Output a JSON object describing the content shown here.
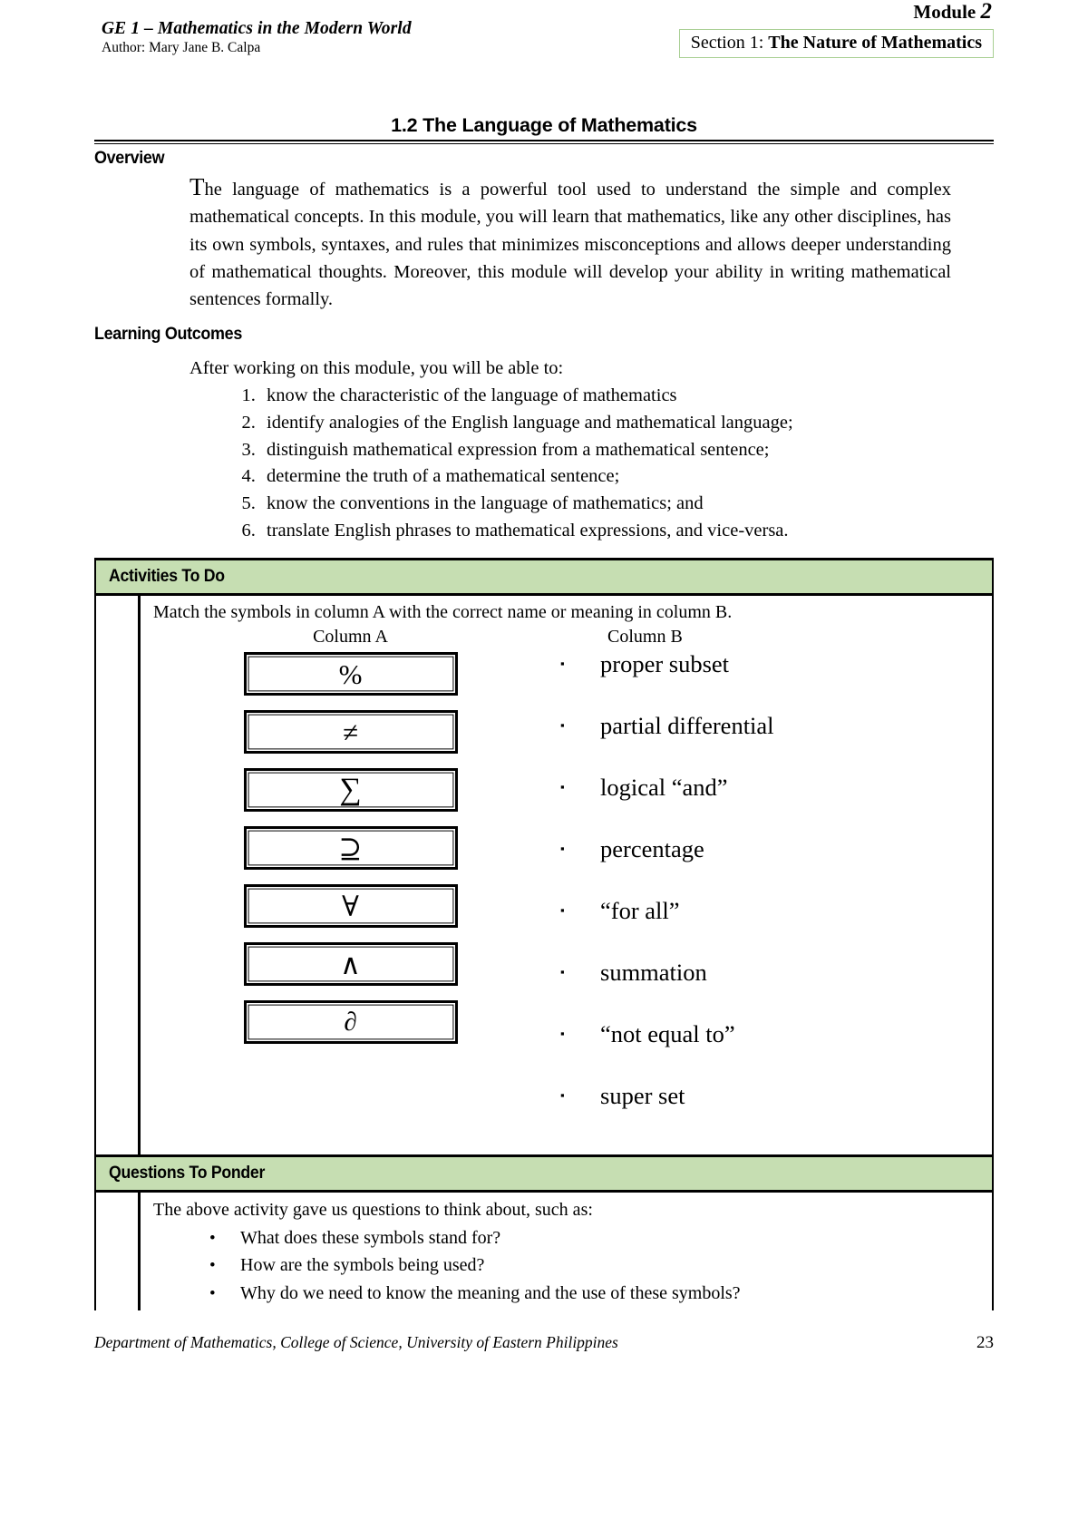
{
  "header": {
    "course_title": "GE 1 – Mathematics in the Modern World",
    "author": "Author: Mary Jane B. Calpa",
    "module_label": "Module",
    "module_number": "2",
    "section_label": "Section 1:",
    "section_name": "The Nature of Mathematics"
  },
  "doc_title": "1.2 The Language of Mathematics",
  "overview": {
    "heading": "Overview",
    "dropcap": "T",
    "paragraph": "he language of mathematics is a powerful tool used to understand the simple and complex mathematical concepts. In this module, you will learn that mathematics, like any other disciplines, has its own symbols, syntaxes, and rules that minimizes misconceptions and allows deeper understanding of mathematical thoughts. Moreover, this module will develop your ability in writing mathematical sentences formally."
  },
  "learning_outcomes": {
    "heading": "Learning Outcomes",
    "lead": "After working on this module, you will be able to:",
    "items": [
      "know the characteristic of the language of mathematics",
      "identify analogies of the English language and mathematical language;",
      "distinguish mathematical expression from a mathematical sentence;",
      "determine the truth of a mathematical sentence;",
      "know the conventions in the language of mathematics; and",
      "translate English phrases to mathematical expressions, and vice-versa."
    ]
  },
  "activities": {
    "heading": "Activities To Do",
    "instruction": "Match the symbols in column A with the correct name or meaning in column B.",
    "column_a_heading": "Column A",
    "column_b_heading": "Column B",
    "column_a_symbols": [
      {
        "glyph": "%",
        "name": "percent-symbol"
      },
      {
        "glyph": "≠",
        "name": "not-equal-symbol"
      },
      {
        "glyph": "∑",
        "name": "summation-symbol"
      },
      {
        "glyph": "⊇",
        "name": "superset-symbol"
      },
      {
        "glyph": "∀",
        "name": "for-all-symbol"
      },
      {
        "glyph": "∧",
        "name": "logical-and-symbol"
      },
      {
        "glyph": "∂",
        "name": "partial-derivative-symbol"
      }
    ],
    "column_b_items": [
      "proper subset",
      "partial differential",
      "logical “and”",
      "percentage",
      "“for all”",
      "summation",
      "“not equal to”",
      "super set"
    ],
    "bullet_glyph": "▪"
  },
  "questions": {
    "heading": "Questions To Ponder",
    "lead": "The above activity gave us questions to think about, such as:",
    "bullet_glyph": "•",
    "items": [
      "What does these symbols stand for?",
      "How are the symbols being used?",
      "Why do we need to know the meaning and the use of these symbols?"
    ]
  },
  "footer": {
    "text": "Department of Mathematics, College of Science, University of Eastern Philippines",
    "page_number": "23"
  },
  "colors": {
    "accent_green": "#c6deb2",
    "section_box_border": "#a9cf93"
  }
}
